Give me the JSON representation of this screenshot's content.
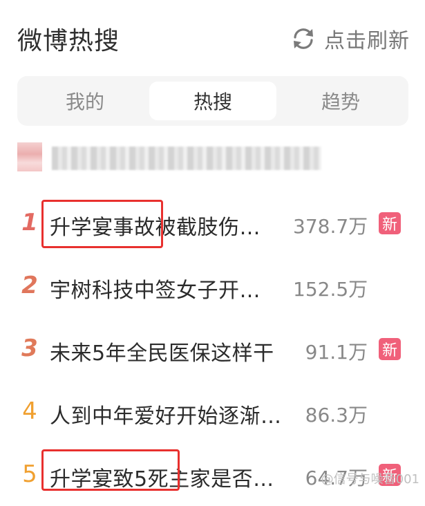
{
  "header": {
    "title": "微博热搜",
    "refresh_label": "点击刷新",
    "refresh_icon": "refresh-icon"
  },
  "tabs": [
    {
      "label": "我的",
      "active": false
    },
    {
      "label": "热搜",
      "active": true
    },
    {
      "label": "趋势",
      "active": false
    }
  ],
  "list": [
    {
      "rank": "1",
      "topic": "升学宴事故被截肢伤…",
      "count": "378.7万",
      "badge": "新",
      "rank_color": "#e36a62",
      "highlighted": true
    },
    {
      "rank": "2",
      "topic": "宇树科技中签女子开…",
      "count": "152.5万",
      "badge": "",
      "rank_color": "#e0765c",
      "highlighted": false
    },
    {
      "rank": "3",
      "topic": "未来5年全民医保这样干",
      "count": "91.1万",
      "badge": "新",
      "rank_color": "#e07a5a",
      "highlighted": false
    },
    {
      "rank": "4",
      "topic": "人到中年爱好开始逐渐…",
      "count": "86.3万",
      "badge": "",
      "rank_color": "#f0a030",
      "highlighted": false
    },
    {
      "rank": "5",
      "topic": "升学宴致5死主家是否…",
      "count": "64.7万",
      "badge": "新",
      "rank_color": "#f0a030",
      "highlighted": true
    }
  ],
  "colors": {
    "badge_bg": "#f0607a",
    "highlight": "#e8302e"
  },
  "watermark": "@信号与噪音001"
}
